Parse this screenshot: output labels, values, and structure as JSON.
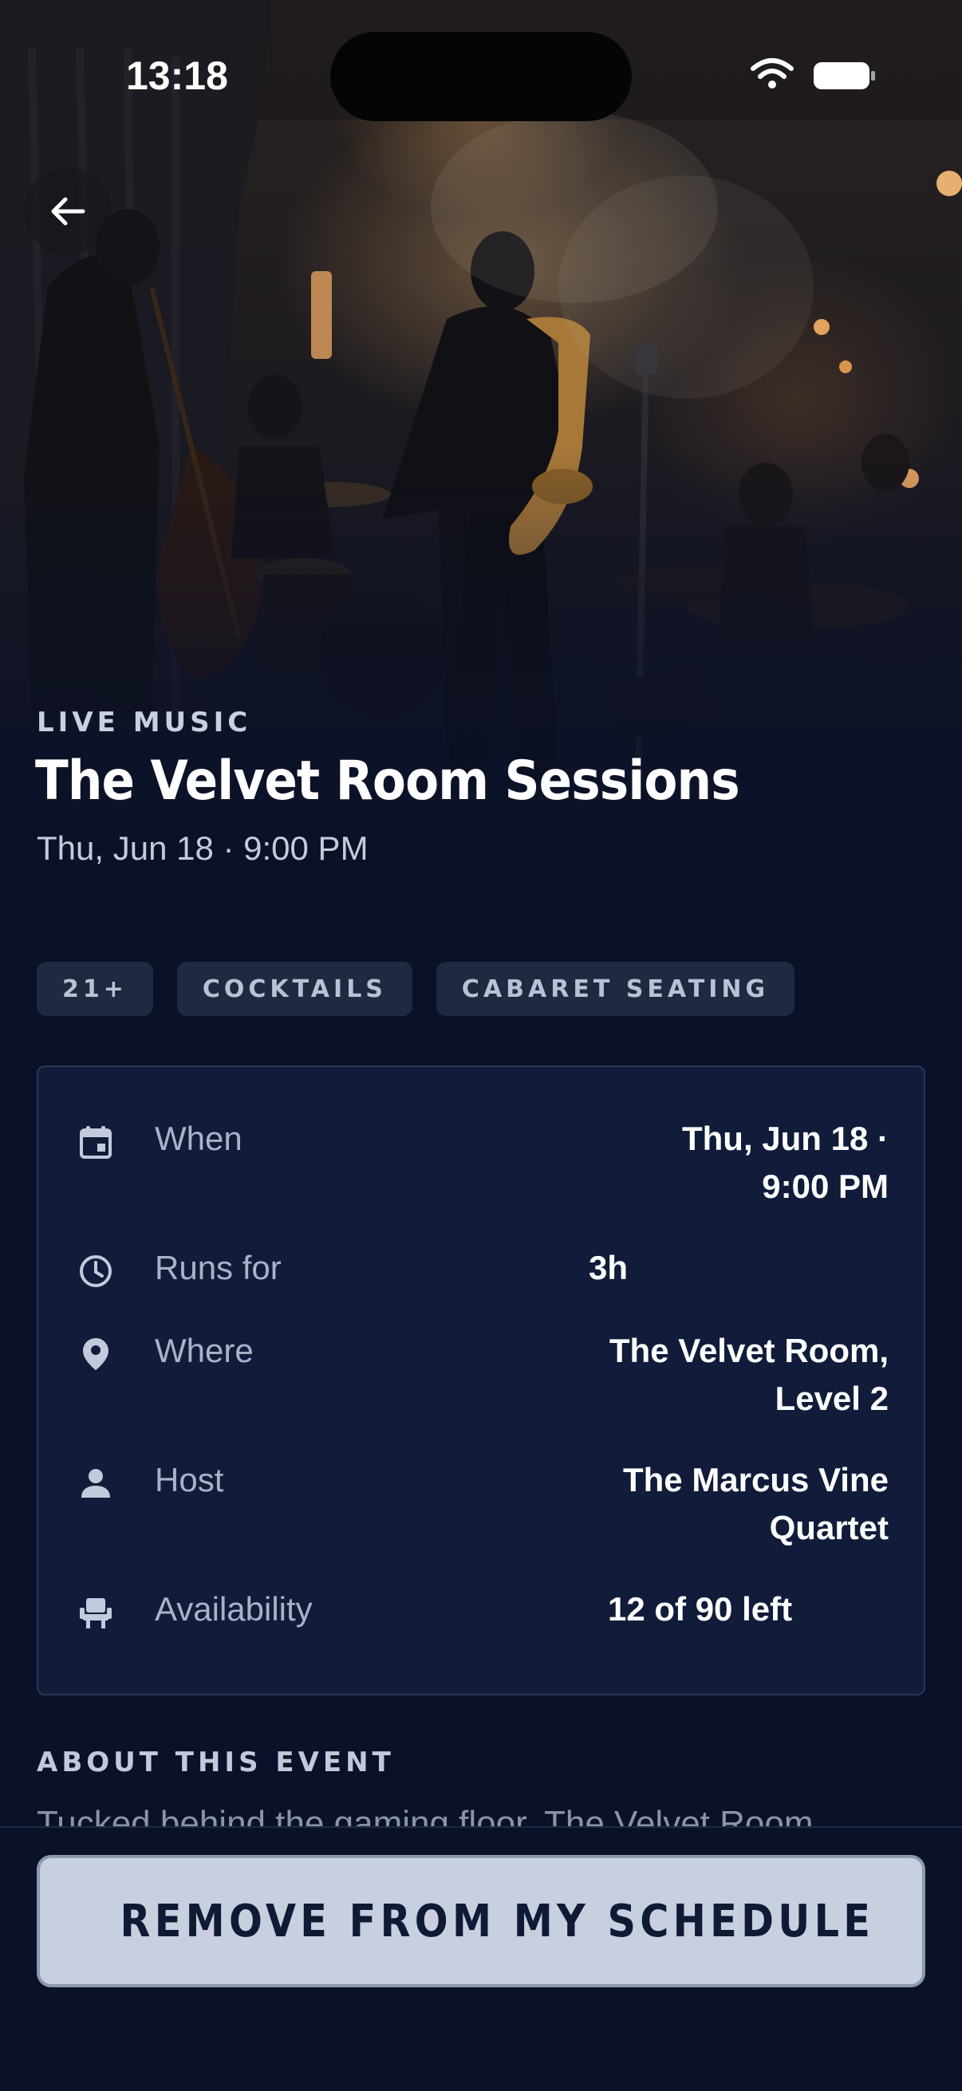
{
  "status_bar": {
    "time": "13:18",
    "icons": [
      "wifi-icon",
      "battery-icon"
    ]
  },
  "hero": {
    "image": "jazz saxophonist performing on a smoky lounge stage",
    "back_icon": "arrow-left-icon",
    "category": "LIVE MUSIC",
    "title": "The Velvet Room Sessions",
    "datetime": "Thu, Jun 18 · 9:00 PM"
  },
  "tags": [
    "21+",
    "COCKTAILS",
    "CABARET SEATING"
  ],
  "details": [
    {
      "icon": "calendar-icon",
      "label": "When",
      "value_lines": [
        "Thu, Jun 18 ·",
        "9:00 PM"
      ]
    },
    {
      "icon": "clock-icon",
      "label": "Runs for",
      "value_lines": [
        "3h"
      ]
    },
    {
      "icon": "location-pin-icon",
      "label": "Where",
      "value_lines": [
        "The Velvet Room,",
        "Level 2"
      ]
    },
    {
      "icon": "person-icon",
      "label": "Host",
      "value_lines": [
        "The Marcus Vine",
        "Quartet"
      ]
    },
    {
      "icon": "seat-icon",
      "label": "Availability",
      "value_lines": [
        "12 of 90 left"
      ]
    }
  ],
  "about": {
    "heading": "ABOUT THIS EVENT",
    "text": "Tucked behind the gaming floor, The Velvet Room"
  },
  "action": {
    "label": "REMOVE FROM MY SCHEDULE",
    "icon": "checkmark-icon"
  },
  "colors": {
    "background": "#0a1128",
    "card": "#111c3a",
    "tag": "#1e2942",
    "button": "#c8cfdf",
    "button_text": "#0f1a35"
  }
}
